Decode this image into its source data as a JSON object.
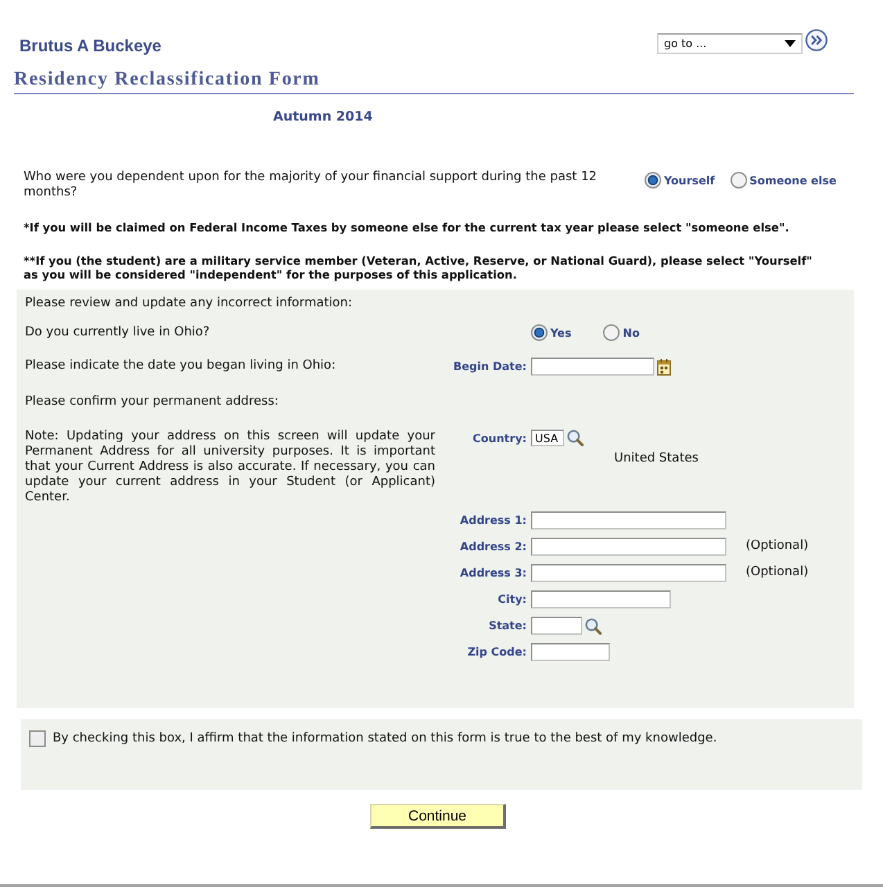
{
  "header": {
    "user_name": "Brutus A Buckeye",
    "goto": {
      "value": "go to ..."
    }
  },
  "form_title": "Residency Reclassification Form",
  "term": "Autumn 2014",
  "dependency": {
    "question": "Who were you dependent upon for the majority of your financial support during the past 12 months?",
    "options": [
      {
        "label": "Yourself",
        "selected": true
      },
      {
        "label": "Someone else",
        "selected": false
      }
    ]
  },
  "notes": [
    "*If you will be claimed on Federal Income Taxes by someone else for the current tax year please select \"someone else\".",
    "**If you (the student) are a military service member (Veteran, Active, Reserve, or National Guard), please select \"Yourself\" as you will be considered \"independent\" for the purposes of this application."
  ],
  "review_panel": {
    "intro": "Please review and update any incorrect information:",
    "ohio_question": "Do you currently live in Ohio?",
    "ohio_options": [
      {
        "label": "Yes",
        "selected": true
      },
      {
        "label": "No",
        "selected": false
      }
    ],
    "date_prompt": "Please indicate the date you began living in Ohio:",
    "begin_date": {
      "label": "Begin Date:"
    },
    "address_prompt": "Please confirm your permanent address:",
    "address_note": "Note: Updating your address on this screen will update your Permanent Address for all university purposes. It is important that your Current Address is also accurate. If necessary, you can update your current address in your Student (or Applicant) Center.",
    "country": {
      "label": "Country:",
      "value": "USA",
      "description": "United States"
    },
    "address_fields": [
      {
        "kind": "wide",
        "label": "Address 1:"
      },
      {
        "kind": "wide",
        "label": "Address 2:",
        "note": "(Optional)"
      },
      {
        "kind": "wide",
        "label": "Address 3:",
        "note": "(Optional)"
      },
      {
        "kind": "medium",
        "label": "City:"
      },
      {
        "kind": "lookup",
        "label": "State:"
      },
      {
        "kind": "narrow",
        "label": "Zip Code:"
      }
    ]
  },
  "affirmation": {
    "checked": false,
    "text": "By checking this box, I affirm that the information stated on this form is true to the best of my knowledge."
  },
  "buttons": [
    {
      "label": "Continue"
    }
  ]
}
